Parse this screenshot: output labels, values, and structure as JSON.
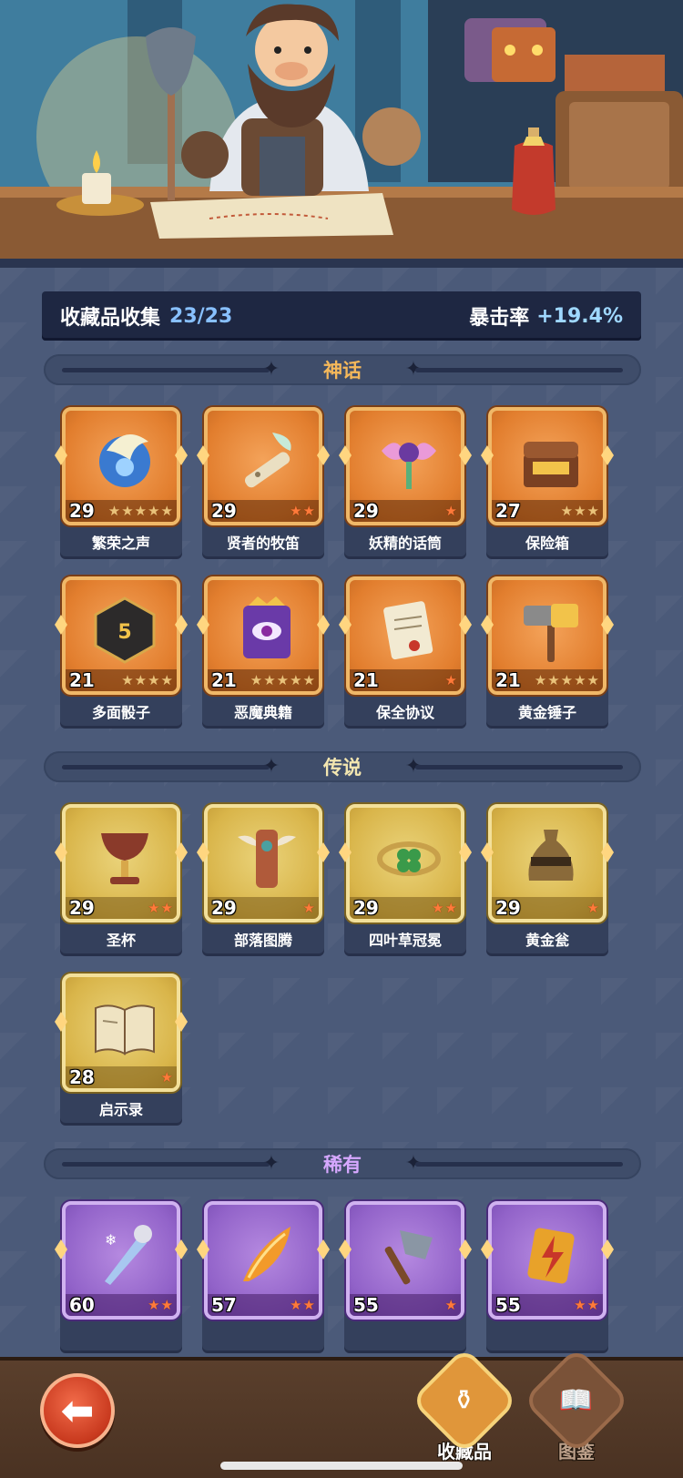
{
  "summary": {
    "title": "收藏品收集",
    "count": "23/23",
    "crit_label": "暴击率",
    "crit_value": "+19.4%"
  },
  "sections": [
    {
      "key": "mythic",
      "title": "神话",
      "title_color": "#f5b85a"
    },
    {
      "key": "legend",
      "title": "传说",
      "title_color": "#f3e6b0"
    },
    {
      "key": "rare",
      "title": "稀有",
      "title_color": "#d6a8ff"
    }
  ],
  "mythic_items": [
    {
      "name": "繁荣之声",
      "level": "29",
      "stars": 5,
      "stars_on": 0,
      "icon": "moon-shell-icon"
    },
    {
      "name": "贤者的牧笛",
      "level": "29",
      "stars": 2,
      "stars_on": 2,
      "icon": "flute-icon"
    },
    {
      "name": "妖精的话筒",
      "level": "29",
      "stars": 1,
      "stars_on": 1,
      "icon": "fairy-microphone-icon"
    },
    {
      "name": "保险箱",
      "level": "27",
      "stars": 3,
      "stars_on": 0,
      "icon": "treasure-chest-icon"
    },
    {
      "name": "多面骰子",
      "level": "21",
      "stars": 4,
      "stars_on": 0,
      "icon": "dice-icon"
    },
    {
      "name": "恶魔典籍",
      "level": "21",
      "stars": 5,
      "stars_on": 0,
      "icon": "demon-book-icon"
    },
    {
      "name": "保全协议",
      "level": "21",
      "stars": 1,
      "stars_on": 1,
      "icon": "contract-scroll-icon"
    },
    {
      "name": "黄金锤子",
      "level": "21",
      "stars": 5,
      "stars_on": 0,
      "icon": "golden-hammer-icon"
    }
  ],
  "legend_items": [
    {
      "name": "圣杯",
      "level": "29",
      "stars": 2,
      "stars_on": 2,
      "icon": "chalice-icon"
    },
    {
      "name": "部落图腾",
      "level": "29",
      "stars": 1,
      "stars_on": 1,
      "icon": "totem-icon"
    },
    {
      "name": "四叶草冠冕",
      "level": "29",
      "stars": 2,
      "stars_on": 2,
      "icon": "clover-crown-icon"
    },
    {
      "name": "黄金瓮",
      "level": "29",
      "stars": 1,
      "stars_on": 1,
      "icon": "golden-urn-icon"
    },
    {
      "name": "启示录",
      "level": "28",
      "stars": 1,
      "stars_on": 1,
      "icon": "open-book-icon"
    }
  ],
  "rare_items": [
    {
      "name": "",
      "level": "60",
      "stars": 2,
      "stars_on": 2,
      "icon": "frost-sword-icon"
    },
    {
      "name": "",
      "level": "57",
      "stars": 2,
      "stars_on": 2,
      "icon": "phoenix-feather-icon"
    },
    {
      "name": "",
      "level": "55",
      "stars": 1,
      "stars_on": 1,
      "icon": "stone-axe-icon"
    },
    {
      "name": "",
      "level": "55",
      "stars": 2,
      "stars_on": 2,
      "icon": "lightning-card-icon"
    }
  ],
  "nav": {
    "back_icon": "back-arrow-icon",
    "tab_collectibles": "收藏品",
    "tab_codex": "图鉴"
  },
  "colors": {
    "mythic_frame": "#e27e2e",
    "legend_frame": "#d9b54a",
    "rare_frame": "#9263c9",
    "panel_bg": "#4b5a79",
    "summary_bg": "#1e2742",
    "accent_blue": "#88c0ff"
  }
}
